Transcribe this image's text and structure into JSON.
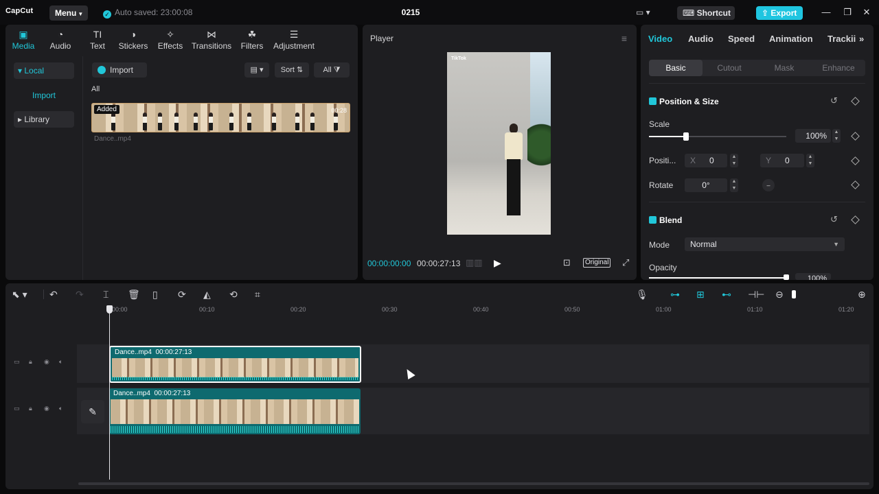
{
  "app": {
    "logo": "CapCut",
    "menu_label": "Menu",
    "autosave": "Auto saved: 23:00:08",
    "title": "0215",
    "shortcut_label": "Shortcut",
    "export_label": "Export"
  },
  "media_tabs": [
    {
      "label": "Media",
      "icon": "media-icon",
      "active": true
    },
    {
      "label": "Audio",
      "icon": "audio-icon"
    },
    {
      "label": "Text",
      "icon": "text-icon"
    },
    {
      "label": "Stickers",
      "icon": "stickers-icon"
    },
    {
      "label": "Effects",
      "icon": "effects-icon"
    },
    {
      "label": "Transitions",
      "icon": "transitions-icon"
    },
    {
      "label": "Filters",
      "icon": "filters-icon"
    },
    {
      "label": "Adjustment",
      "icon": "adjustment-icon"
    }
  ],
  "media_sidebar": {
    "local": "Local",
    "import": "Import",
    "library": "Library"
  },
  "media_toolbar": {
    "import": "Import",
    "sort": "Sort",
    "all_filter": "All"
  },
  "media_section_label": "All",
  "media_clip": {
    "badge": "Added",
    "duration": "00:28",
    "name": "Dance..mp4"
  },
  "player": {
    "title": "Player",
    "current_time": "00:00:00:00",
    "total_time": "00:00:27:13",
    "original_label": "Original",
    "watermark": "TikTok"
  },
  "props_tabs": [
    "Video",
    "Audio",
    "Speed",
    "Animation",
    "Trackii"
  ],
  "props_subtabs": [
    "Basic",
    "Cutout",
    "Mask",
    "Enhance"
  ],
  "position_size": {
    "title": "Position & Size",
    "scale_label": "Scale",
    "scale_value": "100%",
    "scale_fraction": 0.27,
    "position_label": "Positi...",
    "x_label": "X",
    "x_value": "0",
    "y_label": "Y",
    "y_value": "0",
    "rotate_label": "Rotate",
    "rotate_value": "0°"
  },
  "blend": {
    "title": "Blend",
    "mode_label": "Mode",
    "mode_value": "Normal",
    "opacity_label": "Opacity",
    "opacity_value": "100%",
    "opacity_fraction": 1.0
  },
  "ruler_ticks": [
    "00:00",
    "00:10",
    "00:20",
    "00:30",
    "00:40",
    "00:50",
    "01:00",
    "01:10",
    "01:20"
  ],
  "tracks": [
    {
      "clip_name": "Dance..mp4",
      "clip_duration": "00:00:27:13",
      "selected": true
    },
    {
      "clip_name": "Dance..mp4",
      "clip_duration": "00:00:27:13",
      "selected": false
    }
  ],
  "colors": {
    "accent": "#21c7d9",
    "panel": "#1e1e21",
    "clip": "#0e6a6f"
  }
}
